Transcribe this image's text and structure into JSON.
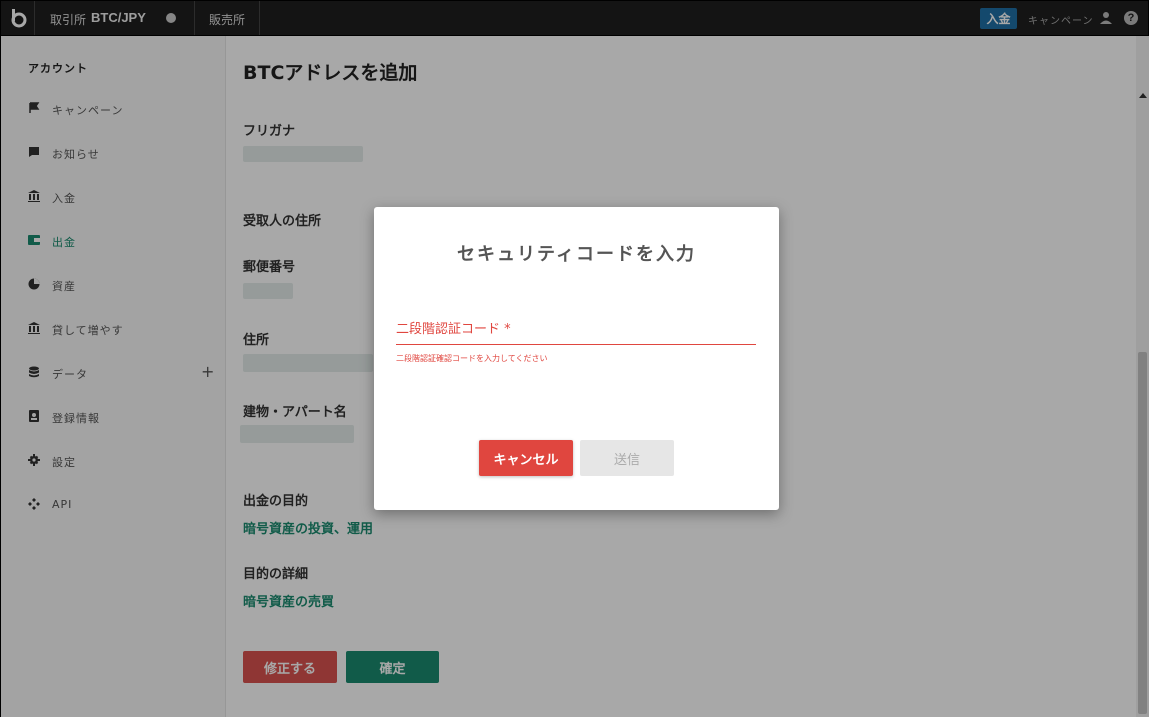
{
  "topbar": {
    "exchange_label": "取引所",
    "pair": "BTC/JPY",
    "sales_label": "販売所",
    "deposit_button": "入金",
    "campaign_link": "キャンペーン",
    "deposit_button_color": "#1f6fa6"
  },
  "sidebar": {
    "heading": "アカウント",
    "items": [
      {
        "label": "キャンペーン",
        "icon": "flag-icon"
      },
      {
        "label": "お知らせ",
        "icon": "message-icon"
      },
      {
        "label": "入金",
        "icon": "bank-icon"
      },
      {
        "label": "出金",
        "icon": "wallet-icon",
        "active": true
      },
      {
        "label": "資産",
        "icon": "pie-chart-icon"
      },
      {
        "label": "貸して増やす",
        "icon": "bank-icon"
      },
      {
        "label": "データ",
        "icon": "database-icon"
      },
      {
        "label": "登録情報",
        "icon": "id-badge-icon"
      },
      {
        "label": "設定",
        "icon": "gear-icon"
      },
      {
        "label": "API",
        "icon": "api-icon"
      }
    ],
    "data_expand": "+",
    "active_color": "#1a8b6f"
  },
  "main": {
    "title": "BTCアドレスを追加",
    "furigana_label": "フリガナ",
    "recipient_address_label": "受取人の住所",
    "postal_code_label": "郵便番号",
    "address_label": "住所",
    "building_label": "建物・アパート名",
    "purpose_label": "出金の目的",
    "purpose_value": "暗号資産の投資、運用",
    "purpose_detail_label": "目的の詳細",
    "purpose_detail_value": "暗号資産の売買",
    "edit_button": "修正する",
    "confirm_button": "確定"
  },
  "modal": {
    "title": "セキュリティコードを入力",
    "field_label": "二段階認証コード *",
    "field_value": "",
    "error_text": "二段階認証確認コードを入力してください",
    "cancel_button": "キャンセル",
    "send_button": "送信",
    "error_color": "#e0463f"
  }
}
